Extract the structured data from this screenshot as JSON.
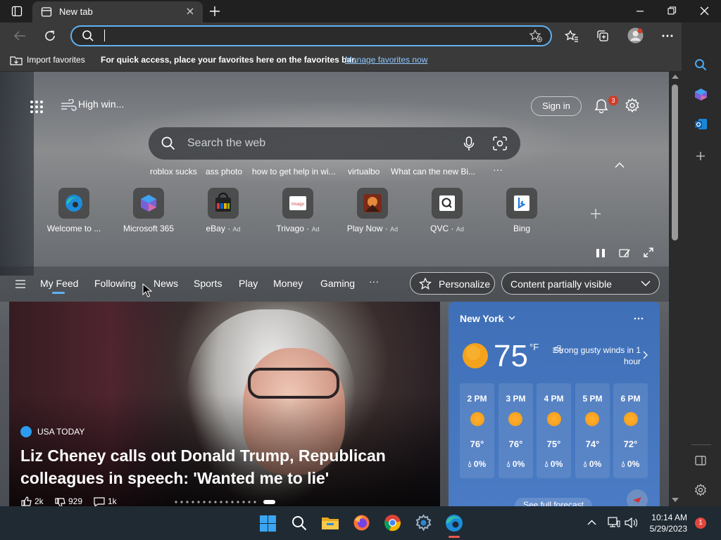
{
  "window": {
    "tab_title": "New tab",
    "new_tab_button": "+"
  },
  "address_bar": {
    "value": "",
    "placeholder": ""
  },
  "favorites_bar": {
    "import_label": "Import favorites",
    "hint": "For quick access, place your favorites here on the favorites bar.",
    "manage_link": "Manage favorites now"
  },
  "header": {
    "weather_summary": "High win...",
    "sign_in": "Sign in",
    "notification_count": "3"
  },
  "search": {
    "placeholder": "Search the web",
    "suggestions": [
      "roblox sucks",
      "ass photo",
      "how to get help in wi...",
      "virtualbo",
      "What can the new Bi..."
    ],
    "more": "···"
  },
  "quick_links": [
    {
      "label": "Welcome to ...",
      "ad": ""
    },
    {
      "label": "Microsoft 365",
      "ad": ""
    },
    {
      "label": "eBay",
      "ad": "Ad"
    },
    {
      "label": "Trivago",
      "ad": "Ad"
    },
    {
      "label": "Play Now",
      "ad": "Ad"
    },
    {
      "label": "QVC",
      "ad": "Ad"
    },
    {
      "label": "Bing",
      "ad": ""
    }
  ],
  "feed_nav": {
    "items": [
      "My Feed",
      "Following",
      "News",
      "Sports",
      "Play",
      "Money",
      "Gaming"
    ],
    "more": "···",
    "personalize": "Personalize",
    "content_visibility": "Content partially visible"
  },
  "news": {
    "source": "USA TODAY",
    "headline": "Liz Cheney calls out Donald Trump, Republican colleagues in speech: 'Wanted me to lie'",
    "likes": "2k",
    "dislikes": "929",
    "comments": "1k"
  },
  "weather": {
    "city": "New York",
    "temperature": "75",
    "unit": "°F",
    "alert": "Strong gusty winds in 1 hour",
    "hourly": [
      {
        "hour": "2 PM",
        "temp": "76°",
        "precip": "0%"
      },
      {
        "hour": "3 PM",
        "temp": "76°",
        "precip": "0%"
      },
      {
        "hour": "4 PM",
        "temp": "75°",
        "precip": "0%"
      },
      {
        "hour": "5 PM",
        "temp": "74°",
        "precip": "0%"
      },
      {
        "hour": "6 PM",
        "temp": "72°",
        "precip": "0%"
      }
    ],
    "full_forecast": "See full forecast"
  },
  "taskbar": {
    "time": "10:14 AM",
    "date": "5/29/2023",
    "notifications": "1"
  },
  "colors": {
    "accent": "#5fb2f2",
    "weather_card": "#4a7bc4",
    "taskbar": "#1f2a33"
  }
}
